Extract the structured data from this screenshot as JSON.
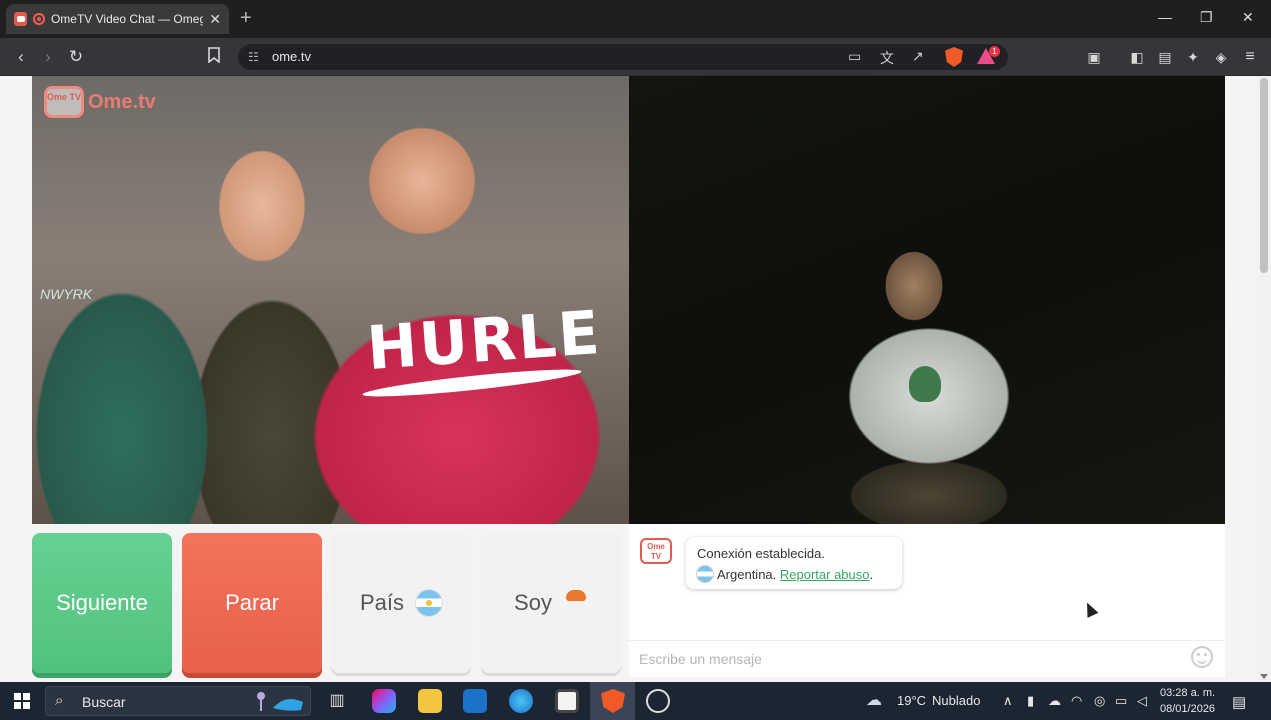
{
  "browser": {
    "tab_title": "OmeTV Video Chat — Omegle",
    "tab_close": "✕",
    "new_tab": "+",
    "url": "ome.tv",
    "brave_badge": "",
    "rewards_badge": "1",
    "window_controls": {
      "minimize": "—",
      "maximize": "❐",
      "close": "✕"
    }
  },
  "page": {
    "logo_text": "Ome.tv",
    "logo_tv": "Ome TV",
    "video_left_shirt_text": "HURLE",
    "video_left_sweater_text": "NWYRK",
    "buttons": {
      "next": "Siguiente",
      "stop": "Parar",
      "country": "País",
      "gender": "Soy"
    },
    "chat": {
      "avatar_text": "Ome TV",
      "connection_status": "Conexión establecida.",
      "country": "Argentina.",
      "report_link": "Reportar abuso",
      "report_trailing": ".",
      "placeholder": "Escribe un mensaje"
    },
    "colors": {
      "next": "#52c17f",
      "stop": "#e9604b",
      "link": "#3aa566"
    }
  },
  "taskbar": {
    "search_placeholder": "Buscar",
    "weather_temp": "19°C",
    "weather_desc": "Nublado",
    "time": "03:28 a. m.",
    "date": "08/01/2026"
  }
}
